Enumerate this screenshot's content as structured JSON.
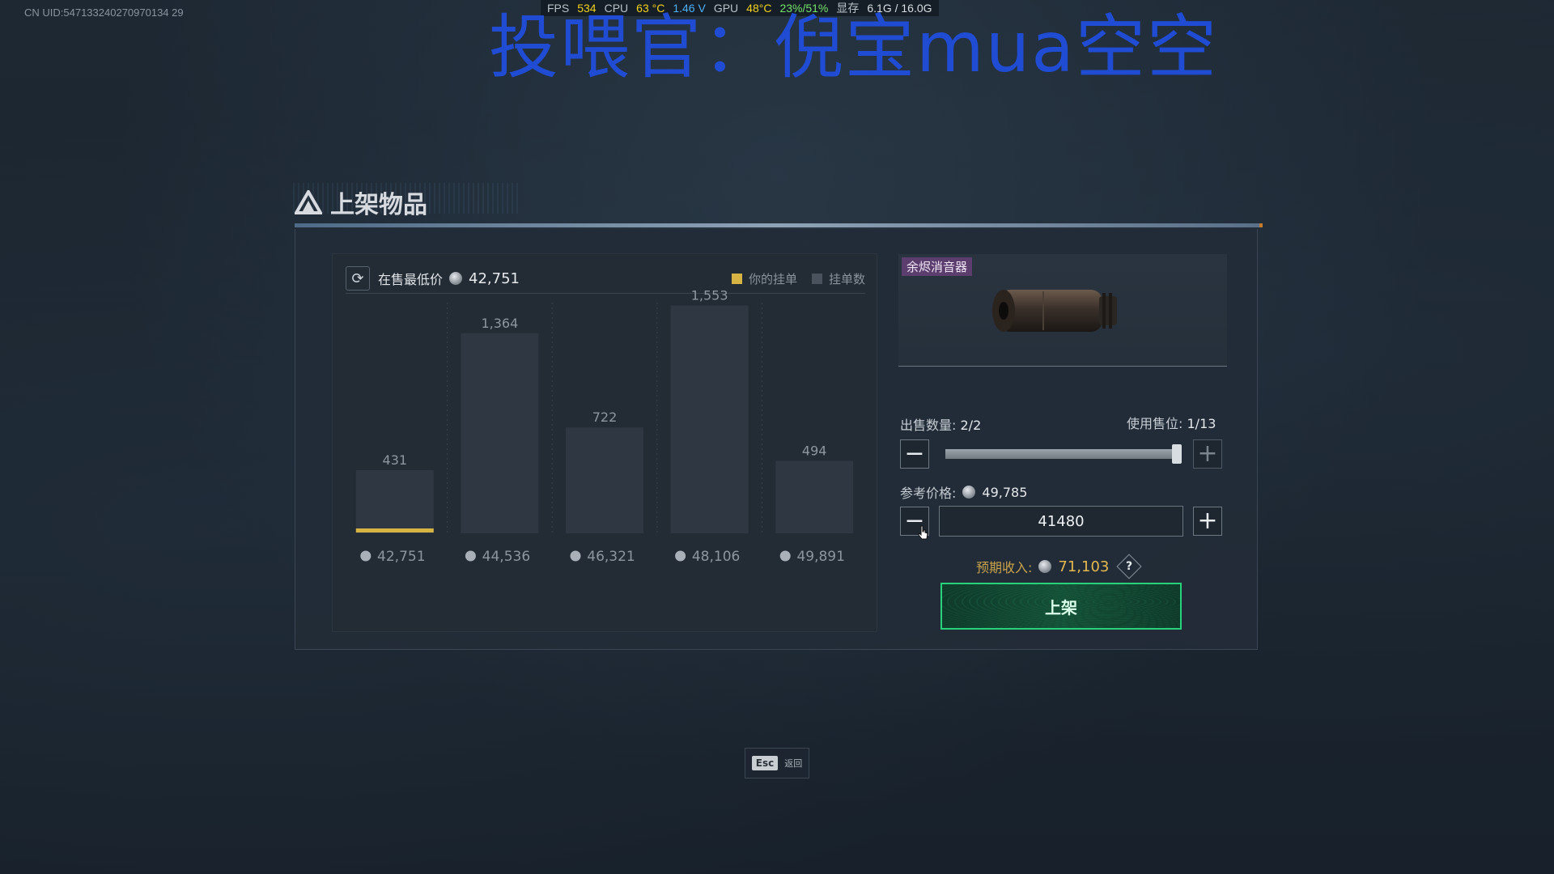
{
  "overlay": {
    "uid": "CN UID:547133240270970134 29",
    "hud": {
      "fps_label": "FPS",
      "fps": "534",
      "cpu_label": "CPU",
      "cpu_temp": "63 °C",
      "cpu_volt": "1.46 V",
      "gpu_label": "GPU",
      "gpu_temp": "48°C",
      "gpu_load": "23%/51%",
      "vram_label": "显存",
      "vram": "6.1G / 16.0G"
    },
    "watermark": "投喂官：倪宝mua空空"
  },
  "panel": {
    "title": "上架物品"
  },
  "chart_header": {
    "lowest_label": "在售最低价",
    "lowest_price": "42,751",
    "legend_yours": "你的挂单",
    "legend_count": "挂单数",
    "colors": {
      "yours": "#d6b443",
      "count": "#4a535d"
    }
  },
  "chart_data": {
    "type": "bar",
    "categories": [
      "42,751",
      "44,536",
      "46,321",
      "48,106",
      "49,891"
    ],
    "series": [
      {
        "name": "挂单数",
        "values": [
          431,
          1364,
          722,
          1553,
          494
        ]
      }
    ],
    "value_labels": [
      "431",
      "1,364",
      "722",
      "1,553",
      "494"
    ],
    "highlight_index": 0,
    "ylim": [
      0,
      1600
    ]
  },
  "item": {
    "name": "余烬消音器"
  },
  "sell": {
    "qty_label": "出售数量:",
    "qty_value": "2/2",
    "slot_label": "使用售位:",
    "slot_value": "1/13",
    "qty_fraction": 1.0,
    "ref_label": "参考价格:",
    "ref_price": "49,785",
    "price_input": "41480",
    "expected_label": "预期收入:",
    "expected_value": "71,103",
    "help": "?",
    "list_button": "上架"
  },
  "footer": {
    "esc_key": "Esc",
    "esc_label": "返回"
  }
}
